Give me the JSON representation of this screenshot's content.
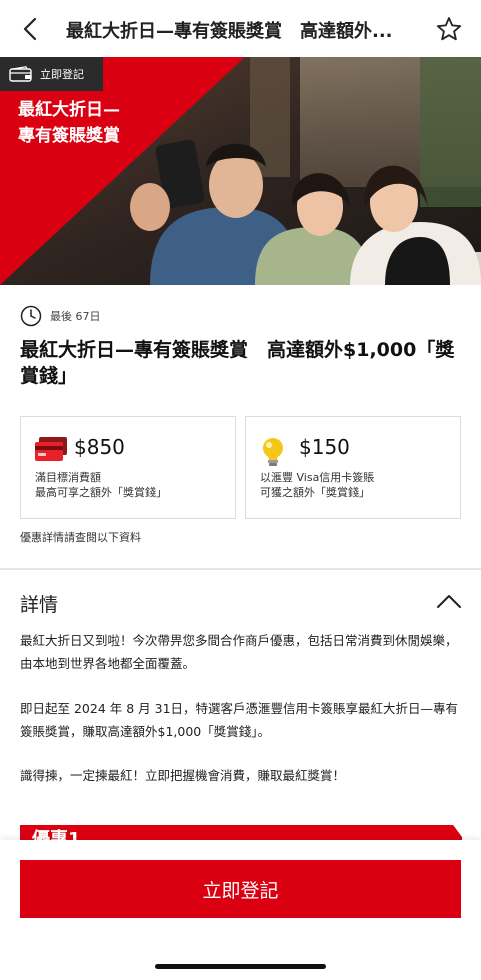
{
  "header": {
    "title": "最紅大折日—專有簽賬獎賞　高達額外...",
    "back_icon": "chevron-left-icon",
    "favorite_icon": "star-outline-icon"
  },
  "banner": {
    "chip_label": "立即登記",
    "chip_icon": "wallet-icon",
    "headline_line1": "最紅大折日—",
    "headline_line2": "專有簽賬獎賞",
    "accent_color": "#db0011"
  },
  "offer": {
    "days_left": "最後 67日",
    "title": "最紅大折日—專有簽賬獎賞　高達額外$1,000「獎賞錢」",
    "cards": [
      {
        "icon": "credit-cards-icon",
        "amount": "$850",
        "desc_line1": "滿目標消費額",
        "desc_line2": "最高可享之額外「獎賞錢」"
      },
      {
        "icon": "lightbulb-icon",
        "amount": "$150",
        "desc_line1": "以滙豐 Visa信用卡簽賬",
        "desc_line2": "可獲之額外「獎賞錢」"
      }
    ],
    "see_below": "優惠詳情請查閱以下資料"
  },
  "details": {
    "title": "詳情",
    "toggle_icon": "chevron-up-icon",
    "paragraphs": [
      "最紅大折日又到啦！今次帶畀您多間合作商戶優惠，包括日常消費到休閒娛樂，由本地到世界各地都全面覆蓋。",
      "即日起至 2024 年 8 月 31日，特選客戶憑滙豐信用卡簽賬享最紅大折日—專有簽賬獎賞，賺取高達額外$1,000「獎賞錢」。",
      "識得揀，一定揀最紅！立即把握機會消費，賺取最紅獎賞！"
    ],
    "offer_strip": "優惠1"
  },
  "footer": {
    "cta_label": "立即登記"
  }
}
